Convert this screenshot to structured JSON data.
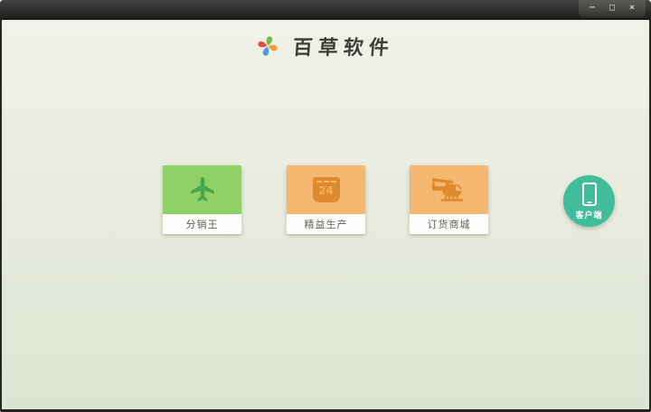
{
  "window": {
    "controls": [
      {
        "name": "minimize",
        "glyph": "−"
      },
      {
        "name": "maximize",
        "glyph": "□"
      },
      {
        "name": "close",
        "glyph": "×"
      }
    ]
  },
  "header": {
    "title": "百草软件",
    "logo_colors": {
      "top": "#6cbd45",
      "right": "#f29b38",
      "bottom": "#4a9bd9",
      "left": "#e0523f"
    }
  },
  "tiles": [
    {
      "label": "分销王",
      "icon": "plane-icon",
      "bg": "#8fd166",
      "icon_color": "#4ba84d"
    },
    {
      "label": "精益生产",
      "icon": "calendar-icon",
      "bg": "#f6b870",
      "icon_color": "#dd8b2e",
      "calendar_day": "24"
    },
    {
      "label": "订货商城",
      "icon": "helicopter-icon",
      "bg": "#f6b870",
      "icon_color": "#dd8b2e"
    }
  ],
  "client_badge": {
    "label": "客户端",
    "bg": "#41bd9c",
    "icon": "phone-icon"
  }
}
